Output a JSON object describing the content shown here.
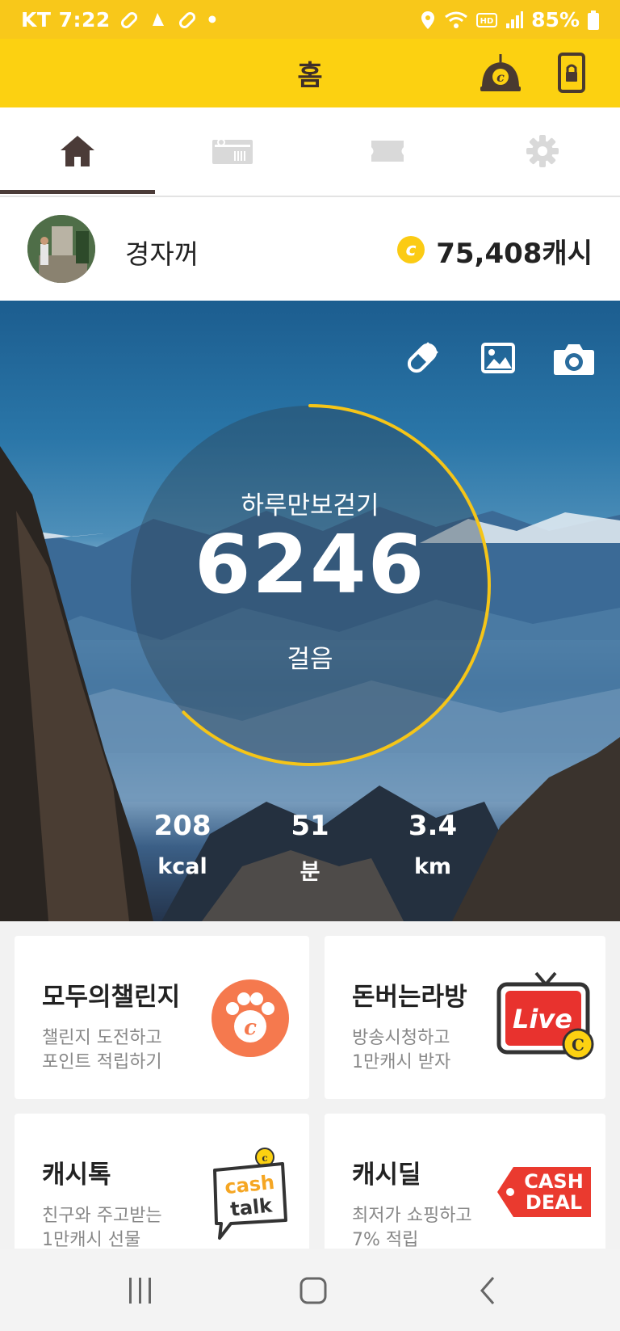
{
  "status_bar": {
    "carrier_time": "KT 7:22",
    "dot": "•",
    "battery": "85%"
  },
  "header": {
    "title": "홈"
  },
  "tabs": [
    {
      "icon": "home-icon",
      "active": true
    },
    {
      "icon": "gift-card-icon",
      "active": false
    },
    {
      "icon": "ticket-icon",
      "active": false
    },
    {
      "icon": "gear-icon",
      "active": false
    }
  ],
  "profile": {
    "nickname": "경자꺼",
    "coin_symbol": "c",
    "cash": "75,408캐시"
  },
  "pedometer": {
    "label": "하루만보걷기",
    "steps": "6246",
    "unit": "걸음",
    "goal_progress": 0.6246,
    "stats": [
      {
        "value": "208",
        "unit": "kcal"
      },
      {
        "value": "51",
        "unit": "분"
      },
      {
        "value": "3.4",
        "unit": "km"
      }
    ]
  },
  "cards": [
    {
      "title": "모두의챌린지",
      "line1": "챌린지 도전하고",
      "line2": "포인트 적립하기",
      "icon": "paw-coin-icon"
    },
    {
      "title": "돈버는라방",
      "line1": "방송시청하고",
      "line2": "1만캐시 받자",
      "icon": "live-tv-icon",
      "badge": "Live"
    },
    {
      "title": "캐시톡",
      "line1": "친구와 주고받는",
      "line2": "1만캐시 선물",
      "icon": "cash-talk-icon",
      "badge1": "cash",
      "badge2": "talk"
    },
    {
      "title": "캐시딜",
      "line1": "최저가 쇼핑하고",
      "line2": "7% 적립",
      "icon": "cash-deal-icon",
      "badge1": "CASH",
      "badge2": "DEAL"
    }
  ],
  "colors": {
    "brand_yellow": "#fcd111",
    "ring": "#f5c518",
    "header_text": "#3e2f2a"
  }
}
